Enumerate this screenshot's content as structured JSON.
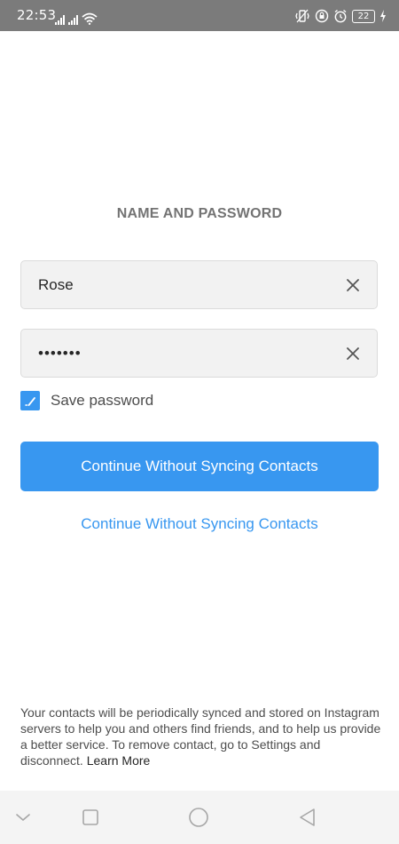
{
  "status_bar": {
    "time": "22:53",
    "battery": "22",
    "left_icons": [
      "signal-icon",
      "signal-icon",
      "wifi-icon"
    ],
    "right_icons": [
      "vibrate-icon",
      "lock-rotation-icon",
      "alarm-icon",
      "battery-icon",
      "charging-icon"
    ]
  },
  "page": {
    "title": "NAME AND PASSWORD"
  },
  "form": {
    "name_value": "Rose",
    "password_value": "•••••••",
    "clear_icon": "close-icon",
    "save_password_label": "Save password",
    "save_password_checked": true
  },
  "actions": {
    "primary_label": "Continue Without Syncing Contacts",
    "secondary_label": "Continue Without Syncing Contacts"
  },
  "footer": {
    "text": "Your contacts will be periodically synced and stored on Instagram servers to help you and others find friends, and to help us provide a better service. To remove contact, go to Settings and disconnect.",
    "learn_more": "Learn More"
  },
  "nav_bar": {
    "icons": [
      "chevron-down-icon",
      "recents-icon",
      "home-icon",
      "back-icon"
    ]
  },
  "colors": {
    "accent": "#3897f0",
    "status_bar": "#7b7b7b",
    "field_bg": "#f2f2f2"
  }
}
